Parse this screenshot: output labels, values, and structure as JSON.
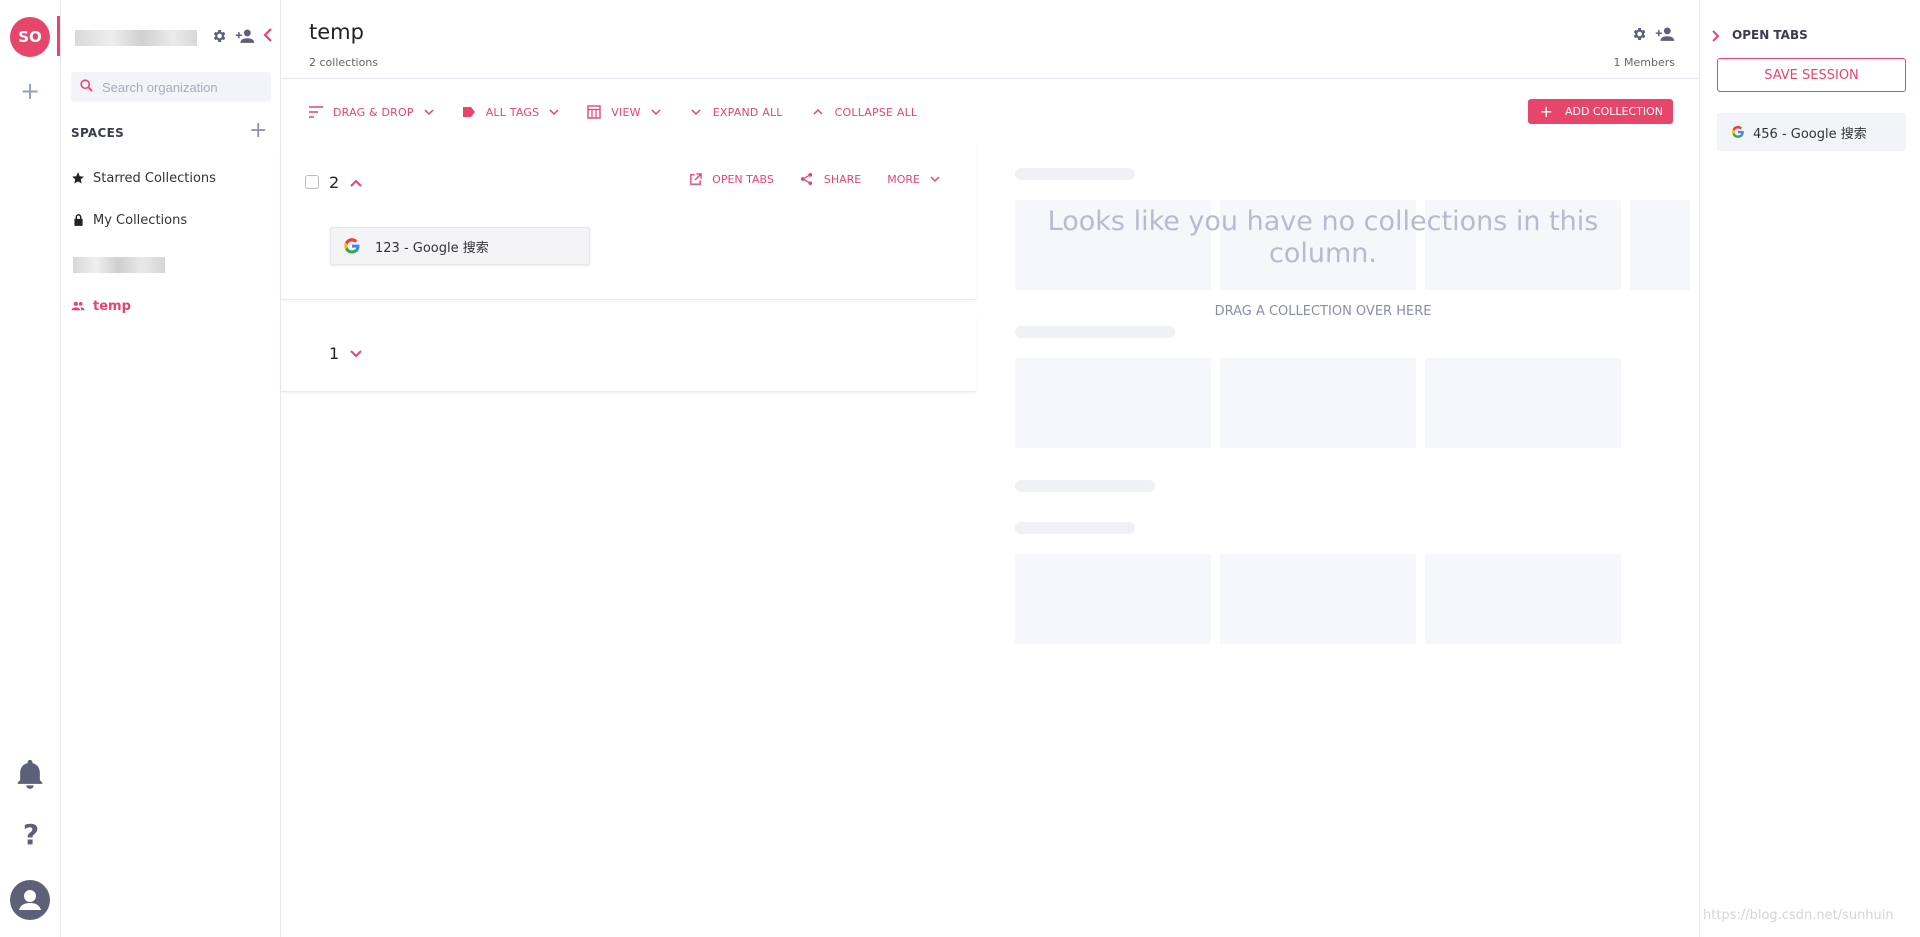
{
  "rail": {
    "avatar_initials": "SO"
  },
  "sidebar": {
    "search_placeholder": "Search organization",
    "spaces_title": "SPACES",
    "items": [
      {
        "label": "Starred Collections",
        "icon": "star-icon"
      },
      {
        "label": "My Collections",
        "icon": "lock-icon"
      },
      {
        "label": "temp",
        "icon": "group-icon"
      }
    ]
  },
  "header": {
    "title": "temp",
    "subtitle": "2 collections",
    "members": "1 Members"
  },
  "toolbar": {
    "drag_drop": "DRAG & DROP",
    "all_tags": "ALL TAGS",
    "view": "VIEW",
    "expand_all": "EXPAND ALL",
    "collapse_all": "COLLAPSE ALL",
    "add_collection": "ADD COLLECTION"
  },
  "collections": [
    {
      "number": "2",
      "actions": {
        "open_tabs": "OPEN TABS",
        "share": "SHARE",
        "more": "MORE"
      },
      "tabs": [
        {
          "title": "123 - Google 搜索"
        }
      ]
    },
    {
      "number": "1"
    }
  ],
  "empty_column": {
    "message": "Looks like you have no collections in this column.",
    "hint": "DRAG A COLLECTION OVER HERE"
  },
  "right_panel": {
    "title": "OPEN TABS",
    "save_session": "SAVE SESSION",
    "tabs": [
      {
        "title": "456 - Google 搜索"
      }
    ]
  },
  "watermark": "https://blog.csdn.net/sunhuin",
  "colors": {
    "accent": "#e8456c",
    "muted": "#8d93b0"
  }
}
